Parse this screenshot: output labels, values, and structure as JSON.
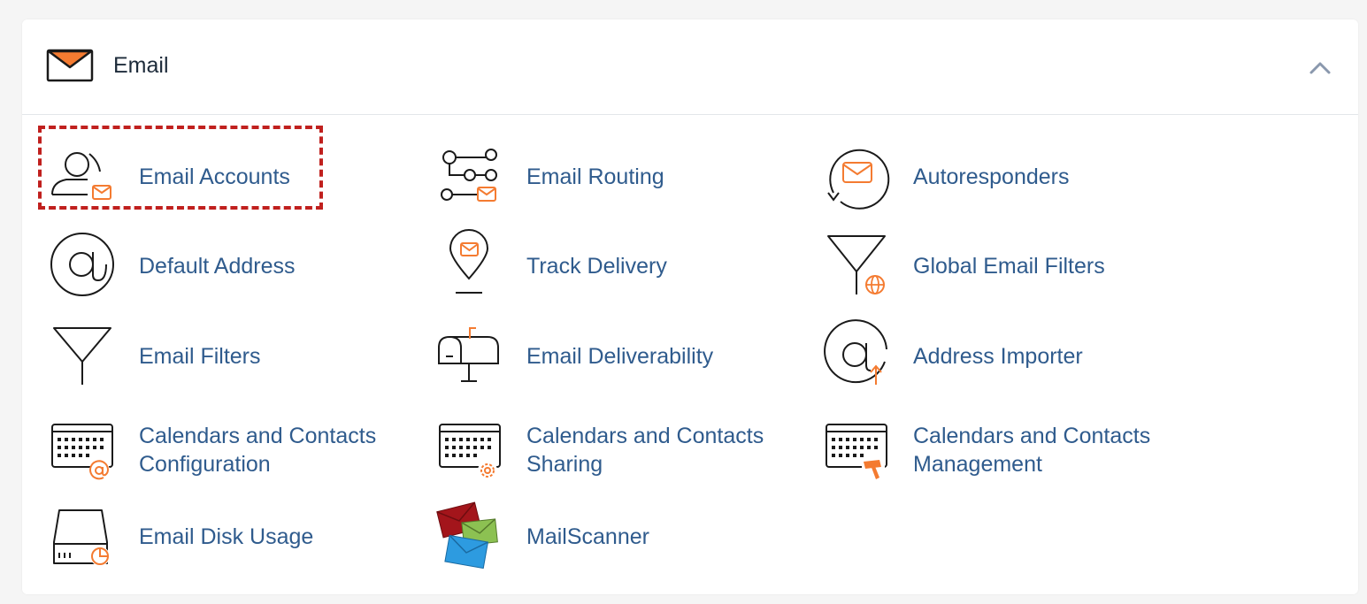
{
  "section": {
    "title": "Email",
    "icon": "envelope-icon",
    "collapse_icon": "chevron-up-icon"
  },
  "items": [
    {
      "label": "Email Accounts",
      "icon": "user-mail-icon"
    },
    {
      "label": "Email Routing",
      "icon": "routing-icon"
    },
    {
      "label": "Autoresponders",
      "icon": "autoresponder-icon"
    },
    {
      "label": "Default Address",
      "icon": "at-sign-icon"
    },
    {
      "label": "Track Delivery",
      "icon": "location-pin-mail-icon"
    },
    {
      "label": "Global Email Filters",
      "icon": "funnel-globe-icon"
    },
    {
      "label": "Email Filters",
      "icon": "funnel-icon"
    },
    {
      "label": "Email Deliverability",
      "icon": "mailbox-icon"
    },
    {
      "label": "Address Importer",
      "icon": "at-import-icon"
    },
    {
      "label": "Calendars and Contacts Configuration",
      "icon": "calendar-at-icon"
    },
    {
      "label": "Calendars and Contacts Sharing",
      "icon": "calendar-gear-icon"
    },
    {
      "label": "Calendars and Contacts Management",
      "icon": "calendar-hammer-icon"
    },
    {
      "label": "Email Disk Usage",
      "icon": "disk-usage-icon"
    },
    {
      "label": "MailScanner",
      "icon": "mailscanner-envelopes-icon"
    }
  ],
  "colors": {
    "accent": "#f47b31",
    "link": "#2f5b8d",
    "highlight": "#c0201e",
    "line": "#1a1a1a"
  }
}
